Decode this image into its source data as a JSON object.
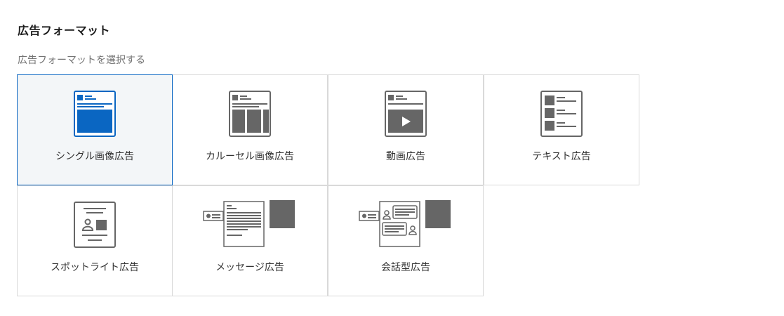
{
  "header": {
    "title": "広告フォーマット",
    "subtitle": "広告フォーマットを選択する"
  },
  "colors": {
    "selected_border": "#0a66c2",
    "selected_icon": "#0a66c2",
    "icon_gray": "#666666",
    "card_border": "#d9d9d9"
  },
  "formats": [
    {
      "label": "シングル画像広告",
      "icon": "single-image-ad-icon",
      "selected": true
    },
    {
      "label": "カルーセル画像広告",
      "icon": "carousel-image-ad-icon",
      "selected": false
    },
    {
      "label": "動画広告",
      "icon": "video-ad-icon",
      "selected": false
    },
    {
      "label": "テキスト広告",
      "icon": "text-ad-icon",
      "selected": false
    },
    {
      "label": "スポットライト広告",
      "icon": "spotlight-ad-icon",
      "selected": false
    },
    {
      "label": "メッセージ広告",
      "icon": "message-ad-icon",
      "selected": false
    },
    {
      "label": "会話型広告",
      "icon": "conversation-ad-icon",
      "selected": false
    }
  ]
}
